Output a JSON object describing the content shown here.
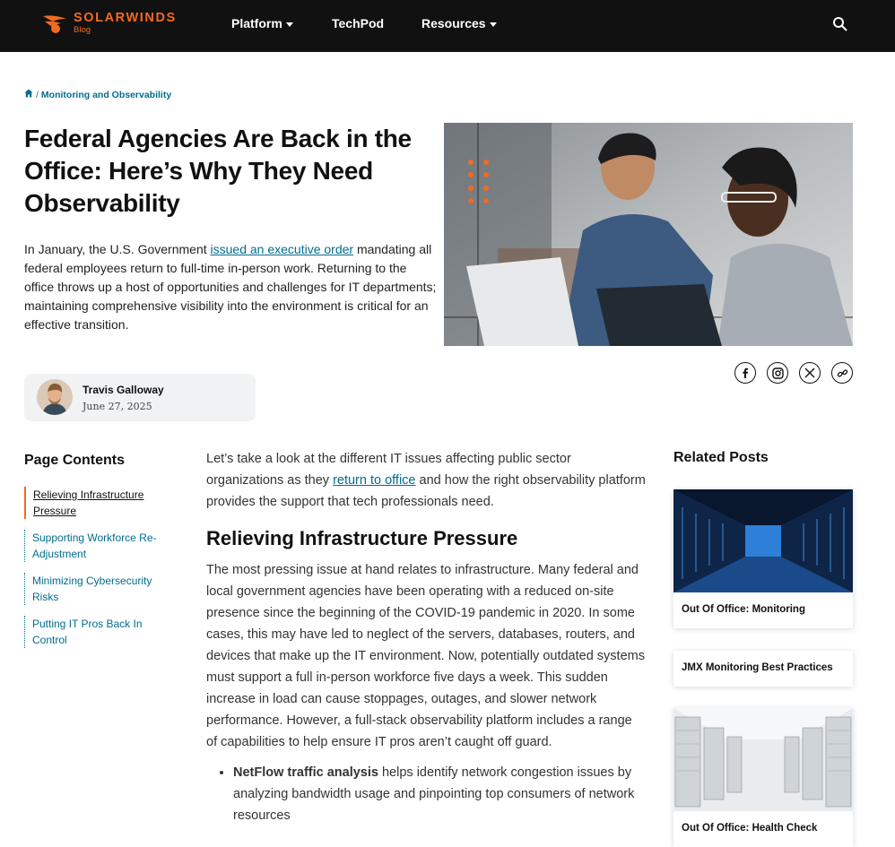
{
  "header": {
    "brand": "SOLARWINDS",
    "brand_sub": "Blog",
    "nav": [
      {
        "label": "Platform",
        "has_caret": true
      },
      {
        "label": "TechPod",
        "has_caret": false
      },
      {
        "label": "Resources",
        "has_caret": true
      }
    ],
    "search_icon": "search-icon"
  },
  "breadcrumb": {
    "home_icon": "home-icon",
    "separator": "/",
    "current": "Monitoring and Observability"
  },
  "article": {
    "title": "Federal Agencies Are Back in the Office: Here’s Why They Need Observability",
    "intro_before": "In January, the U.S. Government ",
    "intro_link": "issued an executive order",
    "intro_after": " mandating all federal employees return to full-time in-person work. Returning to the office throws up a host of opportunities and challenges for IT departments; maintaining comprehensive visibility into the environment is critical for an effective transition.",
    "author_name": "Travis Galloway",
    "author_date": "June 27, 2025",
    "social": [
      "facebook-icon",
      "instagram-icon",
      "x-icon",
      "link-icon"
    ],
    "lead_before": "Let’s take a look at the different IT issues affecting public sector organizations as they ",
    "lead_link": "return to office",
    "lead_after": " and how the right observability platform provides the support that tech professionals need.",
    "section1_heading": "Relieving Infrastructure Pressure",
    "section1_body": "The most pressing issue at hand relates to infrastructure. Many federal and local government agencies have been operating with a reduced on-site presence since the beginning of the COVID-19 pandemic in 2020. In some cases, this may have led to neglect of the servers, databases, routers, and devices that make up the IT environment. Now, potentially outdated systems must support a full in-person workforce five days a week. This sudden increase in load can cause stoppages, outages, and slower network performance. However, a full-stack observability platform includes a range of capabilities to help ensure IT pros aren’t caught off guard.",
    "bullet1_bold": "NetFlow traffic analysis",
    "bullet1_text": " helps identify network congestion issues by analyzing bandwidth usage and pinpointing top consumers of network resources"
  },
  "toc": {
    "title": "Page Contents",
    "items": [
      {
        "label": "Relieving Infrastructure Pressure",
        "active": true
      },
      {
        "label": "Supporting Workforce Re-Adjustment",
        "active": false
      },
      {
        "label": "Minimizing Cybersecurity Risks",
        "active": false
      },
      {
        "label": "Putting IT Pros Back In Control",
        "active": false
      }
    ]
  },
  "related": {
    "title": "Related Posts",
    "posts": [
      {
        "label": "Out Of Office: Monitoring"
      },
      {
        "label": "JMX Monitoring Best Practices"
      },
      {
        "label": "Out Of Office: Health Check"
      }
    ]
  },
  "colors": {
    "brand": "#f26a21",
    "link": "#006d8f",
    "header_bg": "#111111"
  }
}
